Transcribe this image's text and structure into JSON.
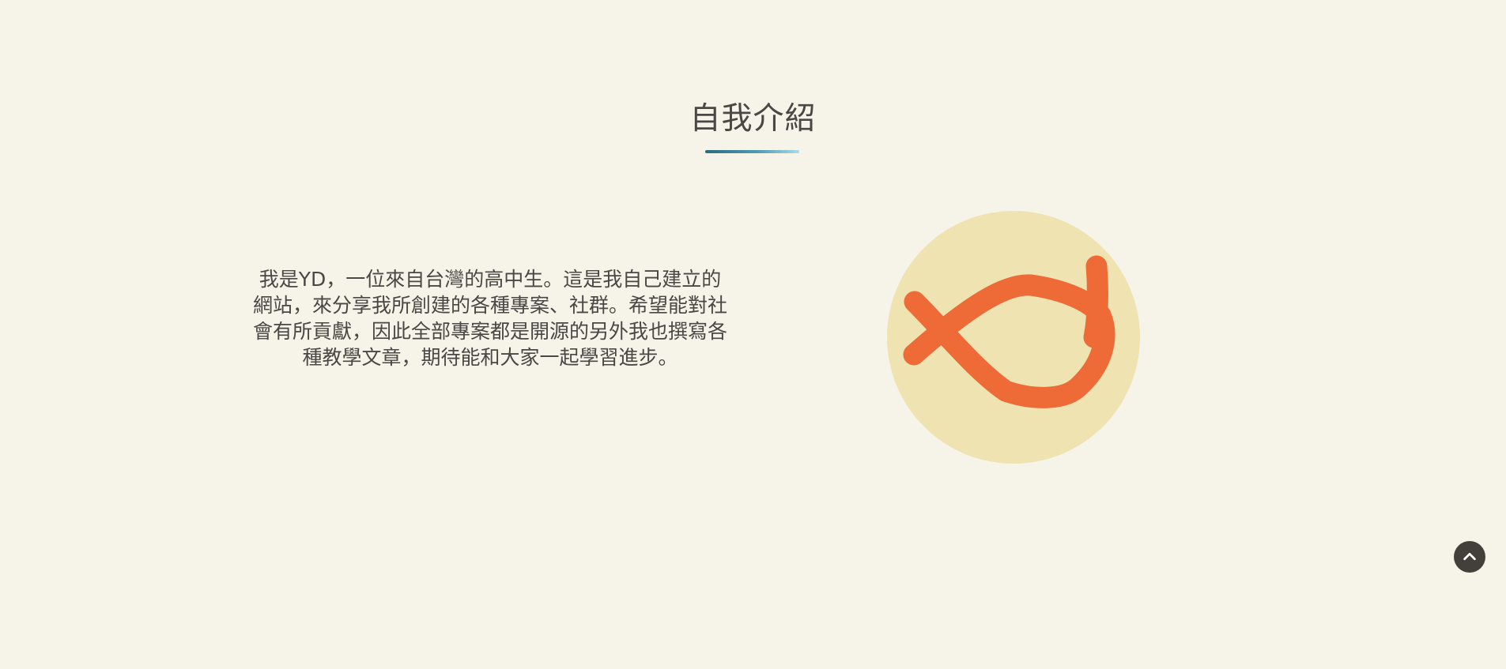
{
  "about": {
    "title": "自我介紹",
    "paragraph": "我是YD，一位來自台灣的高中生。這是我自己建立的網站，來分享我所創建的各種專案、社群。希望能對社會有所貢獻，因此全部專案都是開源的另外我也撰寫各種教學文章，期待能和大家一起學習進步。",
    "avatar": {
      "logo_text": "YD",
      "circle_color": "#efe3b1",
      "stroke_color": "#ee6a37"
    }
  },
  "back_to_top": {
    "icon": "chevron-up-icon"
  },
  "colors": {
    "background": "#f6f3e8",
    "text": "#4a4744",
    "underline_start": "#2b6b7f",
    "underline_end": "#a8dbe9",
    "button_bg": "#433f3b"
  }
}
